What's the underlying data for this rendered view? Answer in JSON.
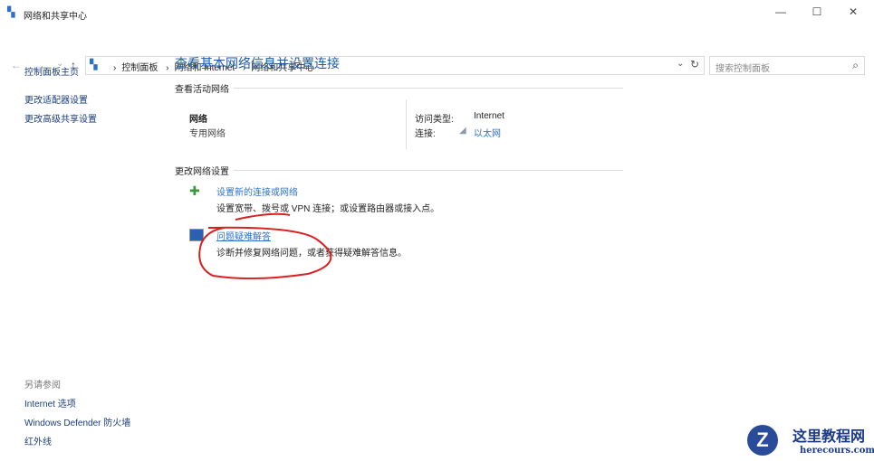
{
  "window": {
    "title": "网络和共享中心",
    "minimize": "—",
    "maximize": "☐",
    "close": "✕"
  },
  "address": {
    "back": "←",
    "forward": "→",
    "recent": "⌄",
    "up": "↑",
    "crumbs": [
      "控制面板",
      "网络和 Internet",
      "网络和共享中心"
    ],
    "separator": "›",
    "dropdown": "⌄",
    "refresh": "↻",
    "search_placeholder": "搜索控制面板",
    "search_icon": "⌕"
  },
  "sidebar": {
    "items": [
      "控制面板主页",
      "更改适配器设置",
      "更改高级共享设置"
    ],
    "see_also_title": "另请参阅",
    "see_also": [
      "Internet 选项",
      "Windows Defender 防火墙",
      "红外线"
    ]
  },
  "main": {
    "title": "查看基本网络信息并设置连接",
    "active_title": "查看活动网络",
    "network_name": "网络",
    "network_type": "专用网络",
    "access_label": "访问类型:",
    "access_value": "Internet",
    "conn_label": "连接:",
    "conn_value": "以太网",
    "change_title": "更改网络设置",
    "tasks": [
      {
        "link": "设置新的连接或网络",
        "desc": "设置宽带、拨号或 VPN 连接；或设置路由器或接入点。"
      },
      {
        "link": "问题疑难解答",
        "desc": "诊断并修复网络问题，或者获得疑难解答信息。"
      }
    ]
  },
  "watermark": {
    "name": "这里教程网",
    "url": "herecours.com"
  }
}
